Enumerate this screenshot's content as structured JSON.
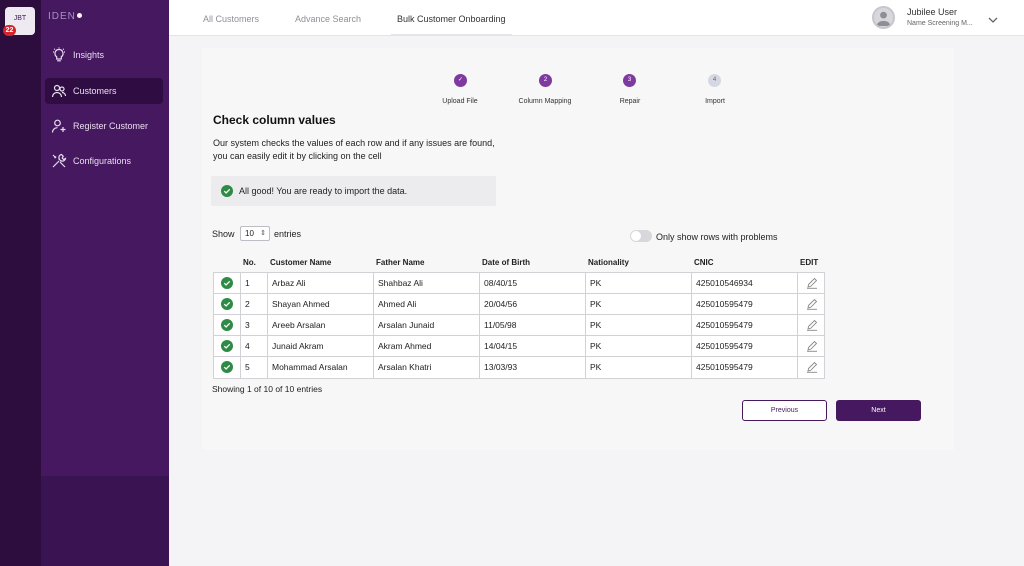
{
  "rail": {
    "tile_text": "JBT",
    "badge": "22"
  },
  "brand": {
    "name": "IDEN"
  },
  "sidebar": {
    "items": [
      {
        "label": "Insights",
        "icon": "lightbulb-icon"
      },
      {
        "label": "Customers",
        "icon": "users-icon",
        "active": true
      },
      {
        "label": "Register Customer",
        "icon": "user-plus-icon"
      },
      {
        "label": "Configurations",
        "icon": "tools-icon"
      }
    ]
  },
  "topbar": {
    "tabs": [
      {
        "label": "All Customers"
      },
      {
        "label": "Advance Search"
      },
      {
        "label": "Bulk Customer Onboarding",
        "active": true
      }
    ],
    "user": {
      "name": "Jubilee User",
      "role": "Name Screening M..."
    }
  },
  "stepper": {
    "steps": [
      {
        "number": "✓",
        "label": "Upload File",
        "state": "done"
      },
      {
        "number": "2",
        "label": "Column Mapping",
        "state": "done"
      },
      {
        "number": "3",
        "label": "Repair",
        "state": "current"
      },
      {
        "number": "4",
        "label": "Import",
        "state": "pending"
      }
    ]
  },
  "main": {
    "title": "Check column values",
    "description_line1": "Our system checks the values of each row and if any issues are found,",
    "description_line2": "you can easily edit it by clicking on the cell",
    "alert": "All good! You are ready to import the data.",
    "show_label": "Show",
    "entries_value": "10",
    "entries_label": "entries",
    "toggle_label": "Only show rows with problems",
    "showing": "Showing 1 of 10 of 10 entries",
    "previous_label": "Previous",
    "next_label": "Next"
  },
  "table": {
    "headers": [
      "No.",
      "Customer Name",
      "Father Name",
      "Date of Birth",
      "Nationality",
      "CNIC",
      "EDIT"
    ],
    "rows": [
      [
        "1",
        "Arbaz Ali",
        "Shahbaz Ali",
        "08/40/15",
        "PK",
        "425010546934"
      ],
      [
        "2",
        "Shayan Ahmed",
        "Ahmed Ali",
        "20/04/56",
        "PK",
        "425010595479"
      ],
      [
        "3",
        "Areeb Arsalan",
        "Arsalan Junaid",
        "11/05/98",
        "PK",
        "425010595479"
      ],
      [
        "4",
        "Junaid Akram",
        "Akram Ahmed",
        "14/04/15",
        "PK",
        "425010595479"
      ],
      [
        "5",
        "Mohammad Arsalan",
        "Arsalan Khatri",
        "13/03/93",
        "PK",
        "425010595479"
      ]
    ]
  },
  "colors": {
    "brand": "#46185f",
    "success": "#2e8b45",
    "step": "#7e3a9e"
  }
}
